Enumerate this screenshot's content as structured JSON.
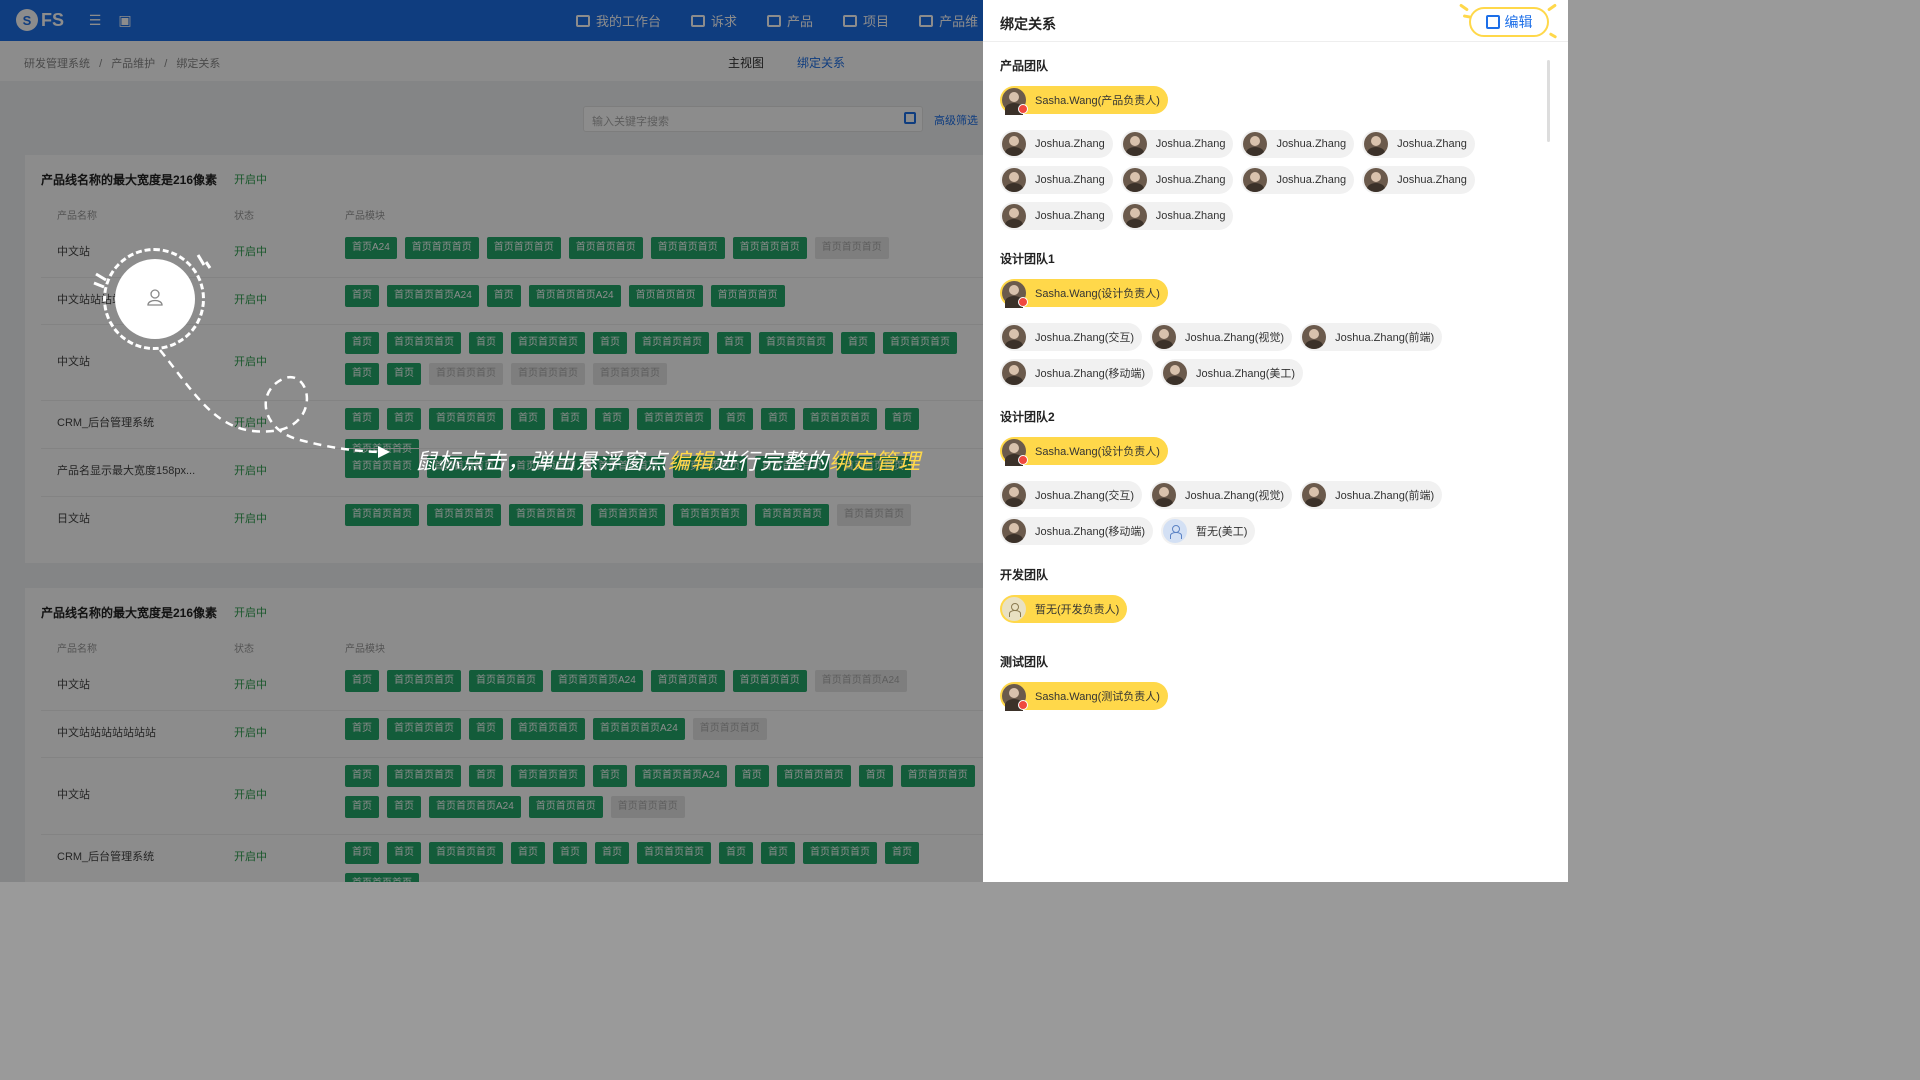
{
  "app": {
    "logo_text": "FS",
    "nav": [
      "我的工作台",
      "诉求",
      "产品",
      "项目",
      "产品维"
    ],
    "breadcrumbs": [
      "研发管理系统",
      "/",
      "产品维护",
      "/",
      "绑定关系"
    ],
    "views": {
      "main": "主视图",
      "bind": "绑定关系"
    },
    "search_placeholder": "输入关键字搜索",
    "advanced_filter": "高级筛选",
    "headers": {
      "name": "产品名称",
      "status": "状态",
      "modules": "产品模块"
    },
    "cards": [
      {
        "title": "产品线名称的最大宽度是216像素",
        "status": "开启中",
        "rows": [
          {
            "name": "中文站",
            "status": "开启中",
            "modules": [
              [
                "首页A24",
                1
              ],
              [
                "首页首页首页",
                1
              ],
              [
                "首页首页首页",
                1
              ],
              [
                "首页首页首页",
                1
              ],
              [
                "首页首页首页",
                1
              ],
              [
                "首页首页首页",
                1
              ],
              [
                "首页首页首页",
                0
              ]
            ]
          },
          {
            "name": "中文站站站站",
            "status": "开启中",
            "modules": [
              [
                "首页",
                1
              ],
              [
                "首页首页首页A24",
                1
              ],
              [
                "首页",
                1
              ],
              [
                "首页首页首页A24",
                1
              ],
              [
                "首页首页首页",
                1
              ],
              [
                "首页首页首页",
                1
              ]
            ]
          },
          {
            "name": "中文站",
            "status": "开启中",
            "modules": [
              [
                "首页",
                1
              ],
              [
                "首页首页首页",
                1
              ],
              [
                "首页",
                1
              ],
              [
                "首页首页首页",
                1
              ],
              [
                "首页",
                1
              ],
              [
                "首页首页首页",
                1
              ],
              [
                "首页",
                1
              ],
              [
                "首页首页首页",
                1
              ],
              [
                "首页",
                1
              ],
              [
                "首页首页首页",
                1
              ],
              [
                "首页",
                1
              ],
              [
                "首页",
                1
              ],
              [
                "首页首页首页",
                0
              ],
              [
                "首页首页首页",
                0
              ],
              [
                "首页首页首页",
                0
              ]
            ]
          },
          {
            "name": "CRM_后台管理系统",
            "status": "开启中",
            "modules": [
              [
                "首页",
                1
              ],
              [
                "首页",
                1
              ],
              [
                "首页首页首页",
                1
              ],
              [
                "首页",
                1
              ],
              [
                "首页",
                1
              ],
              [
                "首页",
                1
              ],
              [
                "首页首页首页",
                1
              ],
              [
                "首页",
                1
              ],
              [
                "首页",
                1
              ],
              [
                "首页首页首页",
                1
              ],
              [
                "首页",
                1
              ],
              [
                "首页首页首页",
                1
              ]
            ]
          },
          {
            "name": "产品名显示最大宽度158px...",
            "status": "开启中",
            "modules": [
              [
                "首页首页首页",
                1
              ],
              [
                "首页首页首页",
                1
              ],
              [
                "首页首页首页",
                1
              ],
              [
                "首页首页首页",
                1
              ],
              [
                "首页首页首页",
                1
              ],
              [
                "首页首页首页",
                1
              ],
              [
                "首页首页首页",
                1
              ]
            ]
          },
          {
            "name": "日文站",
            "status": "开启中",
            "modules": [
              [
                "首页首页首页",
                1
              ],
              [
                "首页首页首页",
                1
              ],
              [
                "首页首页首页",
                1
              ],
              [
                "首页首页首页",
                1
              ],
              [
                "首页首页首页",
                1
              ],
              [
                "首页首页首页",
                1
              ],
              [
                "首页首页首页",
                0
              ]
            ]
          }
        ]
      },
      {
        "title": "产品线名称的最大宽度是216像素",
        "status": "开启中",
        "rows": [
          {
            "name": "中文站",
            "status": "开启中",
            "modules": [
              [
                "首页",
                1
              ],
              [
                "首页首页首页",
                1
              ],
              [
                "首页首页首页",
                1
              ],
              [
                "首页首页首页A24",
                1
              ],
              [
                "首页首页首页",
                1
              ],
              [
                "首页首页首页",
                1
              ],
              [
                "首页首页首页A24",
                0
              ]
            ]
          },
          {
            "name": "中文站站站站站站站",
            "status": "开启中",
            "modules": [
              [
                "首页",
                1
              ],
              [
                "首页首页首页",
                1
              ],
              [
                "首页",
                1
              ],
              [
                "首页首页首页",
                1
              ],
              [
                "首页首页首页A24",
                1
              ],
              [
                "首页首页首页",
                0
              ]
            ]
          },
          {
            "name": "中文站",
            "status": "开启中",
            "modules": [
              [
                "首页",
                1
              ],
              [
                "首页首页首页",
                1
              ],
              [
                "首页",
                1
              ],
              [
                "首页首页首页",
                1
              ],
              [
                "首页",
                1
              ],
              [
                "首页首页首页A24",
                1
              ],
              [
                "首页",
                1
              ],
              [
                "首页首页首页",
                1
              ],
              [
                "首页",
                1
              ],
              [
                "首页首页首页",
                1
              ],
              [
                "首页",
                1
              ],
              [
                "首页",
                1
              ],
              [
                "首页首页首页A24",
                1
              ],
              [
                "首页首页首页",
                1
              ],
              [
                "首页首页首页",
                0
              ]
            ]
          },
          {
            "name": "CRM_后台管理系统",
            "status": "开启中",
            "modules": [
              [
                "首页",
                1
              ],
              [
                "首页",
                1
              ],
              [
                "首页首页首页",
                1
              ],
              [
                "首页",
                1
              ],
              [
                "首页",
                1
              ],
              [
                "首页",
                1
              ],
              [
                "首页首页首页",
                1
              ],
              [
                "首页",
                1
              ],
              [
                "首页",
                1
              ],
              [
                "首页首页首页",
                1
              ],
              [
                "首页",
                1
              ],
              [
                "首页首页首页",
                1
              ]
            ]
          }
        ]
      }
    ]
  },
  "annotation": {
    "text_a": "鼠标点击，弹出悬浮窗点",
    "text_b": "编辑",
    "text_c": "进行完整的",
    "text_d": "绑定管理"
  },
  "drawer": {
    "title": "绑定关系",
    "edit_label": "编辑",
    "teams": [
      {
        "title": "产品团队",
        "members": [
          {
            "name": "Sasha.Wang(产品负责人)",
            "lead": true
          },
          {
            "name": "Joshua.Zhang"
          },
          {
            "name": "Joshua.Zhang"
          },
          {
            "name": "Joshua.Zhang"
          },
          {
            "name": "Joshua.Zhang"
          },
          {
            "name": "Joshua.Zhang"
          },
          {
            "name": "Joshua.Zhang"
          },
          {
            "name": "Joshua.Zhang"
          },
          {
            "name": "Joshua.Zhang"
          },
          {
            "name": "Joshua.Zhang"
          },
          {
            "name": "Joshua.Zhang"
          }
        ]
      },
      {
        "title": "设计团队1",
        "members": [
          {
            "name": "Sasha.Wang(设计负责人)",
            "lead": true
          },
          {
            "name": "Joshua.Zhang(交互)"
          },
          {
            "name": "Joshua.Zhang(视觉)"
          },
          {
            "name": "Joshua.Zhang(前端)"
          },
          {
            "name": "Joshua.Zhang(移动端)"
          },
          {
            "name": "Joshua.Zhang(美工)"
          }
        ]
      },
      {
        "title": "设计团队2",
        "members": [
          {
            "name": "Sasha.Wang(设计负责人)",
            "lead": true
          },
          {
            "name": "Joshua.Zhang(交互)"
          },
          {
            "name": "Joshua.Zhang(视觉)"
          },
          {
            "name": "Joshua.Zhang(前端)"
          },
          {
            "name": "Joshua.Zhang(移动端)"
          },
          {
            "name": "暂无(美工)",
            "empty": "blue"
          }
        ]
      },
      {
        "title": "开发团队",
        "members": [
          {
            "name": "暂无(开发负责人)",
            "lead": true,
            "empty": "yellow"
          }
        ]
      },
      {
        "title": "测试团队",
        "members": [
          {
            "name": "Sasha.Wang(测试负责人)",
            "lead": true
          }
        ]
      }
    ]
  }
}
